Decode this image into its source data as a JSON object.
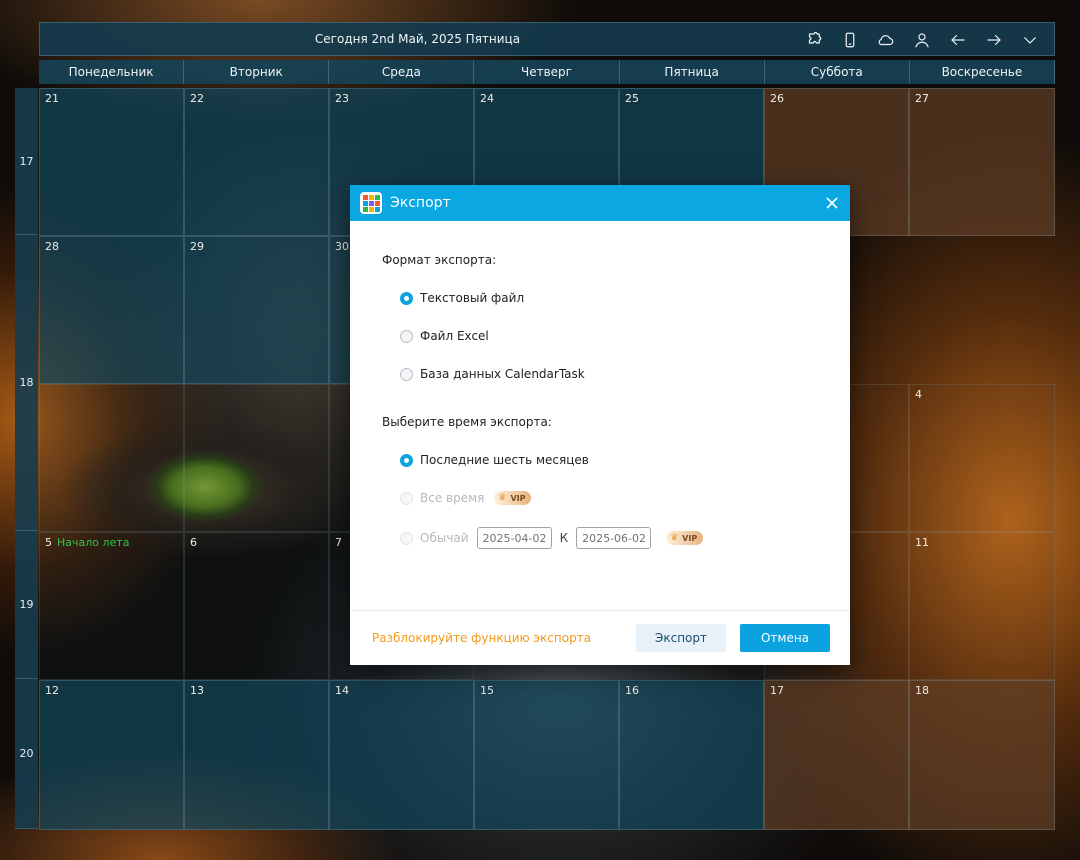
{
  "header": {
    "today_label": "Сегодня 2nd Май, 2025 Пятница",
    "icons": [
      "puzzle-icon",
      "phone-icon",
      "cloud-icon",
      "user-icon",
      "arrow-left-icon",
      "arrow-right-icon",
      "chevron-down-icon"
    ]
  },
  "weekdays": [
    "Понедельник",
    "Вторник",
    "Среда",
    "Четверг",
    "Пятница",
    "Суббота",
    "Воскресенье"
  ],
  "weeks": [
    "17",
    "18",
    "19",
    "20"
  ],
  "cells": {
    "r0": [
      "21",
      "22",
      "23",
      "24",
      "25",
      "26",
      "27"
    ],
    "r1": [
      "28",
      "29",
      "30",
      "",
      "",
      "",
      "4"
    ],
    "r2": [
      "5",
      "6",
      "7",
      "",
      "",
      "",
      "11"
    ],
    "r3": [
      "12",
      "13",
      "14",
      "15",
      "16",
      "17",
      "18"
    ]
  },
  "event_label": "Начало лета",
  "dialog": {
    "title": "Экспорт",
    "format_label": "Формат экспорта:",
    "format_options": [
      "Текстовый файл",
      "Файл Excel",
      "База данных CalendarTask"
    ],
    "time_label": "Выберите время экспорта:",
    "time_options": [
      "Последние шесть месяцев",
      "Все время",
      "Обычай"
    ],
    "vip_label": "VIP",
    "date_from": "2025-04-02",
    "date_sep": "К",
    "date_to": "2025-06-02",
    "unlock_text": "Разблокируйте функцию экспорта",
    "export_button": "Экспорт",
    "cancel_button": "Отмена"
  },
  "colors": {
    "accent": "#0ba7e3",
    "unlock": "#f19a1a",
    "event": "#2ec44a"
  }
}
